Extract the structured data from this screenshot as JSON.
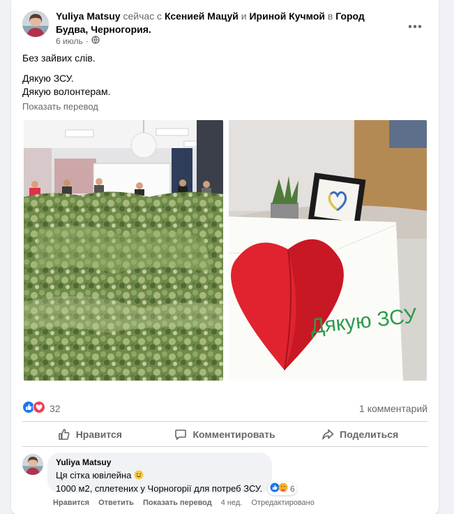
{
  "post": {
    "author": "Yuliya Matsuy",
    "activity": "сейчас с",
    "tagged_1": "Ксенией Мацуй",
    "conj": "и",
    "tagged_2": "Ириной Кучмой",
    "prep_in": "в",
    "location": "Город Будва, Черногория",
    "period": ".",
    "date": "6 июль",
    "date_separator": "·",
    "privacy_icon": "globe-icon",
    "lines": [
      "Без зайвих слів.",
      "Дякую ЗСУ.",
      "Дякую волонтерам."
    ],
    "translate_link": "Показать перевод",
    "photo_2_caption": "Дякую ЗСУ"
  },
  "stats": {
    "reaction_count": "32",
    "comment_count": "1 комментарий"
  },
  "actions": {
    "like": "Нравится",
    "comment": "Комментировать",
    "share": "Поделиться"
  },
  "comment": {
    "author": "Yuliya Matsuy",
    "line1": "Ця сітка ювілейна",
    "line2": "1000 м2, сплетених у Чорногорії для потреб ЗСУ.",
    "reaction_count": "6",
    "actions": {
      "like": "Нравится",
      "reply": "Ответить",
      "translate": "Показать перевод",
      "time": "4 нед.",
      "edited": "Отредактировано"
    }
  },
  "colors": {
    "like_blue": "#1877f2",
    "love_red": "#f33e58",
    "text_secondary": "#65676b",
    "divider": "#ced0d4",
    "bubble_bg": "#f0f2f5"
  }
}
